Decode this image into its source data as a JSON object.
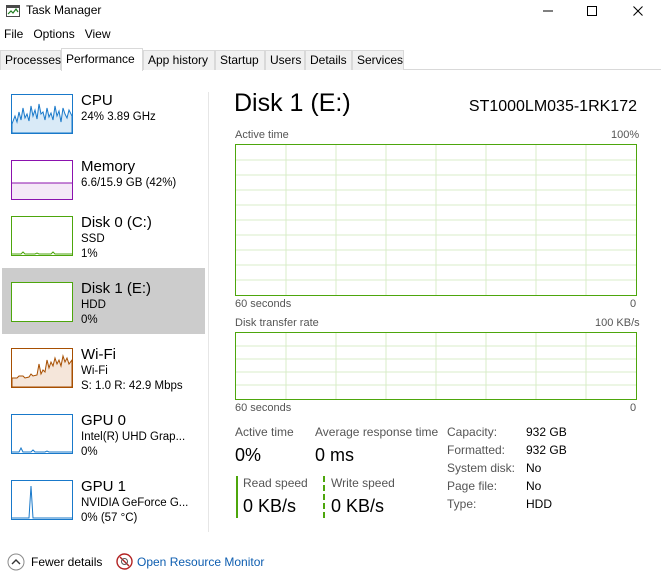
{
  "window": {
    "title": "Task Manager",
    "controls": [
      "minimize",
      "maximize",
      "close"
    ]
  },
  "menu": [
    "File",
    "Options",
    "View"
  ],
  "tabs": [
    {
      "label": "Processes",
      "active": false
    },
    {
      "label": "Performance",
      "active": true
    },
    {
      "label": "App history",
      "active": false
    },
    {
      "label": "Startup",
      "active": false
    },
    {
      "label": "Users",
      "active": false
    },
    {
      "label": "Details",
      "active": false
    },
    {
      "label": "Services",
      "active": false
    }
  ],
  "sidebar": [
    {
      "title": "CPU",
      "line1": "24% 3.89 GHz",
      "line2": "",
      "color": "#1979ca",
      "selected": false
    },
    {
      "title": "Memory",
      "line1": "6.6/15.9 GB (42%)",
      "line2": "",
      "color": "#8b12ae",
      "selected": false
    },
    {
      "title": "Disk 0 (C:)",
      "line1": "SSD",
      "line2": "1%",
      "color": "#4da60c",
      "selected": false
    },
    {
      "title": "Disk 1 (E:)",
      "line1": "HDD",
      "line2": "0%",
      "color": "#4da60c",
      "selected": true
    },
    {
      "title": "Wi-Fi",
      "line1": "Wi-Fi",
      "line2": "S: 1.0  R: 42.9 Mbps",
      "color": "#a74f01",
      "selected": false
    },
    {
      "title": "GPU 0",
      "line1": "Intel(R) UHD Grap...",
      "line2": "0%",
      "color": "#1979ca",
      "selected": false
    },
    {
      "title": "GPU 1",
      "line1": "NVIDIA GeForce G...",
      "line2": "0% (57 °C)",
      "color": "#1979ca",
      "selected": false
    }
  ],
  "main": {
    "title": "Disk 1 (E:)",
    "model": "ST1000LM035-1RK172",
    "active_graph": {
      "label": "Active time",
      "max_label": "100%",
      "time_label": "60 seconds",
      "min_label": "0"
    },
    "transfer_graph": {
      "label": "Disk transfer rate",
      "max_label": "100 KB/s",
      "time_label": "60 seconds",
      "min_label": "0"
    },
    "stats": {
      "active_time_label": "Active time",
      "active_time_value": "0%",
      "avg_response_label": "Average response time",
      "avg_response_value": "0 ms",
      "read_speed_label": "Read speed",
      "read_speed_value": "0 KB/s",
      "write_speed_label": "Write speed",
      "write_speed_value": "0 KB/s"
    },
    "properties": [
      {
        "label": "Capacity:",
        "value": "932 GB"
      },
      {
        "label": "Formatted:",
        "value": "932 GB"
      },
      {
        "label": "System disk:",
        "value": "No"
      },
      {
        "label": "Page file:",
        "value": "No"
      },
      {
        "label": "Type:",
        "value": "HDD"
      }
    ]
  },
  "footer": {
    "fewer_details": "Fewer details",
    "resource_monitor": "Open Resource Monitor"
  },
  "colors": {
    "accent_disk": "#4da60c",
    "link": "#0e5eb0",
    "selected_bg": "#cccccc"
  }
}
